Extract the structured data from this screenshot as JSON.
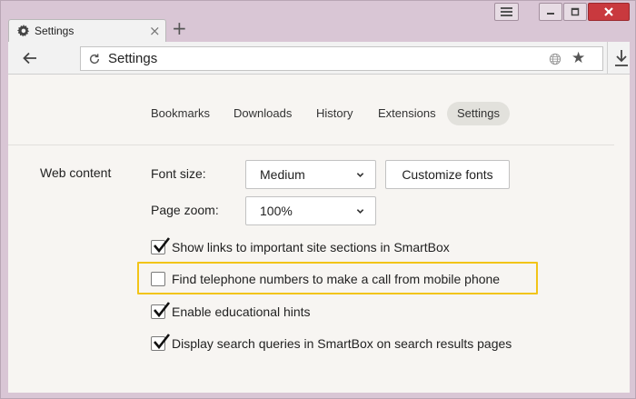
{
  "browser": {
    "tab": {
      "title": "Settings",
      "icon": "gear-icon"
    },
    "new_tab_label": "+",
    "window_controls": [
      "menu-icon",
      "minimize-icon",
      "maximize-icon",
      "close-icon"
    ],
    "address_bar": {
      "text": "Settings"
    }
  },
  "settings_nav": {
    "items": [
      {
        "label": "Bookmarks",
        "active": false
      },
      {
        "label": "Downloads",
        "active": false
      },
      {
        "label": "History",
        "active": false
      },
      {
        "label": "Extensions",
        "active": false
      },
      {
        "label": "Settings",
        "active": true
      }
    ]
  },
  "web_content": {
    "section_label": "Web content",
    "font_size": {
      "label": "Font size:",
      "value": "Medium"
    },
    "customize_fonts_label": "Customize fonts",
    "page_zoom": {
      "label": "Page zoom:",
      "value": "100%"
    },
    "options": [
      {
        "label": "Show links to important site sections in SmartBox",
        "checked": true
      },
      {
        "label": "Find telephone numbers to make a call from mobile phone",
        "checked": false,
        "highlighted": true
      },
      {
        "label": "Enable educational hints",
        "checked": true
      },
      {
        "label": "Display search queries in SmartBox on search results pages",
        "checked": true
      }
    ]
  },
  "colors": {
    "highlight": "#f2c418",
    "window_frame": "#d9c6d5",
    "content_bg": "#f7f5f2",
    "close_button": "#c9393e"
  }
}
